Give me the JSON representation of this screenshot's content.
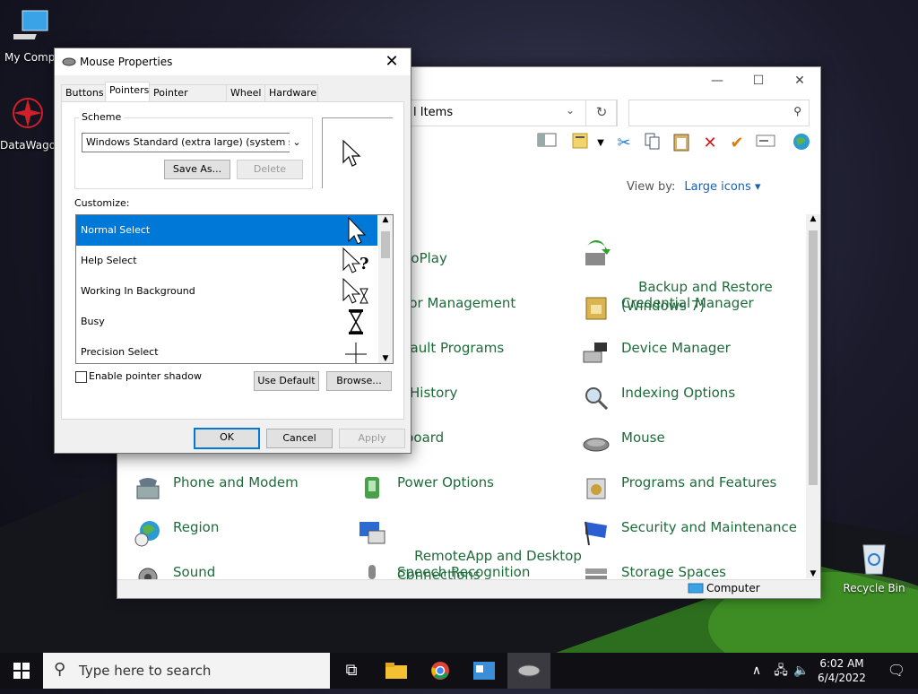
{
  "desktop": {
    "icons": [
      {
        "label": "My Compu"
      },
      {
        "label": "DataWago"
      },
      {
        "label": "Recycle Bin"
      }
    ]
  },
  "control_panel": {
    "address": "l Items",
    "toolbar_icons": [
      "view-pane-icon",
      "properties-icon",
      "cut-icon",
      "copy-icon",
      "paste-icon",
      "delete-icon",
      "check-icon",
      "rename-icon",
      "globe-icon"
    ],
    "view_by_label": "View by:",
    "view_by_value": "Large icons",
    "items": [
      {
        "label": "utoPlay",
        "icon": "autoplay-icon"
      },
      {
        "label": "Backup and Restore\n(Windows 7)",
        "icon": "backup-icon"
      },
      {
        "label": "olor Management",
        "icon": "color-management-icon"
      },
      {
        "label": "Credential Manager",
        "icon": "credential-icon"
      },
      {
        "label": "efault Programs",
        "icon": "default-programs-icon"
      },
      {
        "label": "Device Manager",
        "icon": "device-manager-icon"
      },
      {
        "label": "e History",
        "icon": "file-history-icon"
      },
      {
        "label": "Indexing Options",
        "icon": "indexing-icon"
      },
      {
        "label": "yboard",
        "icon": "keyboard-icon"
      },
      {
        "label": "Mouse",
        "icon": "mouse-icon"
      },
      {
        "label": "Phone and Modem",
        "icon": "phone-icon"
      },
      {
        "label": "Power Options",
        "icon": "power-icon"
      },
      {
        "label": "Programs and Features",
        "icon": "programs-icon"
      },
      {
        "label": "Region",
        "icon": "region-icon"
      },
      {
        "label": "RemoteApp and Desktop\nConnections",
        "icon": "remoteapp-icon"
      },
      {
        "label": "Security and Maintenance",
        "icon": "security-icon"
      },
      {
        "label": "Sound",
        "icon": "sound-icon"
      },
      {
        "label": "Speech Recognition",
        "icon": "speech-icon"
      },
      {
        "label": "Storage Spaces",
        "icon": "storage-icon"
      }
    ],
    "status": "Computer"
  },
  "dialog": {
    "title": "Mouse Properties",
    "tabs": [
      "Buttons",
      "Pointers",
      "Pointer Options",
      "Wheel",
      "Hardware"
    ],
    "selected_tab": "Pointers",
    "scheme_label": "Scheme",
    "scheme_value": "Windows Standard (extra large) (system scheme",
    "save_as": "Save As...",
    "delete": "Delete",
    "customize_label": "Customize:",
    "pointers": [
      {
        "label": "Normal Select",
        "cursor": "arrow-cursor-icon"
      },
      {
        "label": "Help Select",
        "cursor": "help-cursor-icon"
      },
      {
        "label": "Working In Background",
        "cursor": "working-cursor-icon"
      },
      {
        "label": "Busy",
        "cursor": "busy-cursor-icon"
      },
      {
        "label": "Precision Select",
        "cursor": "crosshair-cursor-icon"
      }
    ],
    "selected_pointer": "Normal Select",
    "shadow_label": "Enable pointer shadow",
    "shadow_checked": false,
    "use_default": "Use Default",
    "browse": "Browse...",
    "ok": "OK",
    "cancel": "Cancel",
    "apply": "Apply"
  },
  "taskbar": {
    "search_placeholder": "Type here to search",
    "time": "6:02 AM",
    "date": "6/4/2022"
  }
}
